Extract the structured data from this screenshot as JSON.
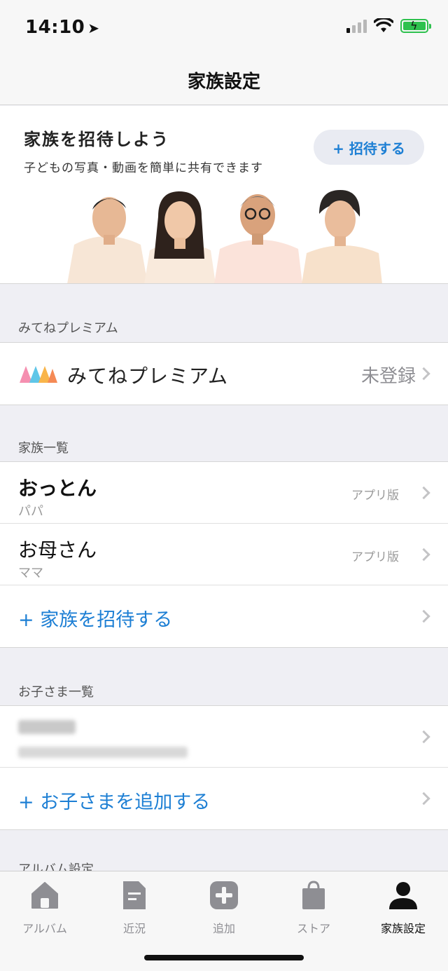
{
  "status_bar": {
    "time": "14:10"
  },
  "nav": {
    "title": "家族設定"
  },
  "invite": {
    "title": "家族を招待しよう",
    "subtitle": "子どもの写真・動画を簡単に共有できます",
    "button_label": "+ 招待する"
  },
  "premium_section": {
    "header": "みてねプレミアム",
    "label": "みてねプレミアム",
    "status": "未登録"
  },
  "family_section": {
    "header": "家族一覧",
    "members": [
      {
        "name": "おっとん",
        "role": "パパ",
        "tag": "アプリ版"
      },
      {
        "name": "お母さん",
        "role": "ママ",
        "tag": "アプリ版"
      }
    ],
    "add_label": "+ 家族を招待する"
  },
  "children_section": {
    "header": "お子さま一覧",
    "add_label": "+ お子さまを追加する"
  },
  "album_section": {
    "header": "アルバム設定"
  },
  "tabs": [
    {
      "label": "アルバム",
      "icon": "home-icon"
    },
    {
      "label": "近況",
      "icon": "document-icon"
    },
    {
      "label": "追加",
      "icon": "plus-icon"
    },
    {
      "label": "ストア",
      "icon": "shopping-bag-icon"
    },
    {
      "label": "家族設定",
      "icon": "person-icon"
    }
  ],
  "colors": {
    "accent": "#1d7fd4",
    "tab_inactive": "#8e8e93",
    "battery": "#2ec14e"
  }
}
